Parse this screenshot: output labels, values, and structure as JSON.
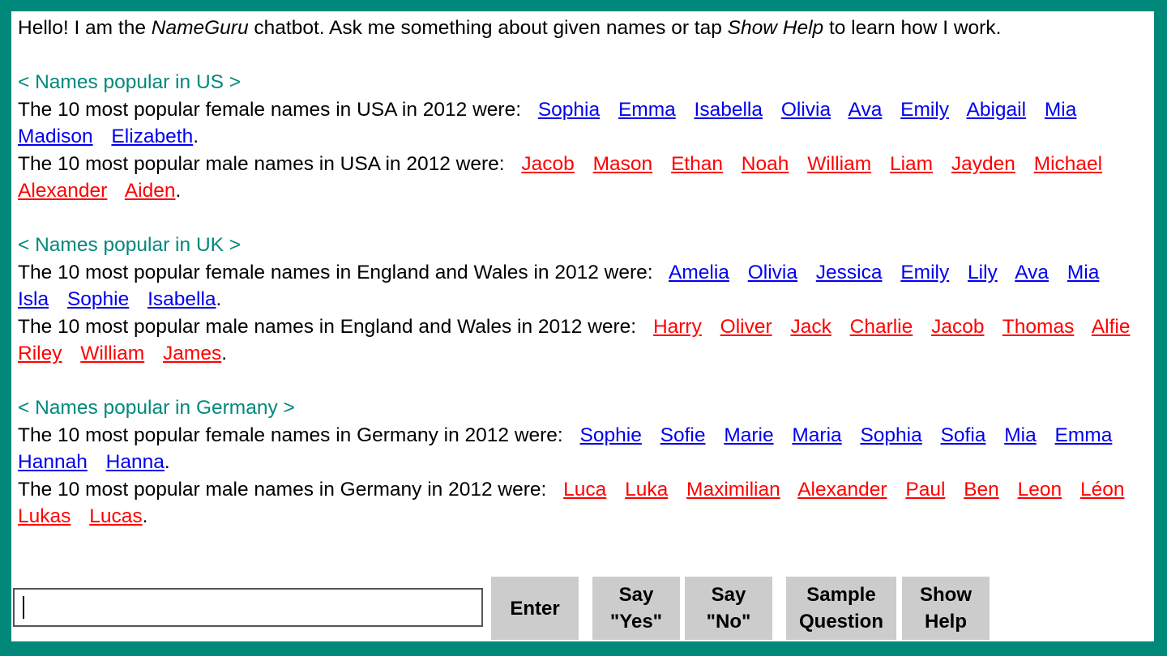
{
  "intro": {
    "text1": "Hello! I am the ",
    "bot_name": "NameGuru",
    "text2": " chatbot. Ask me something about given names or tap ",
    "help_ref": "Show Help",
    "text3": " to learn how I work."
  },
  "sections": [
    {
      "heading": "< Names popular in US >",
      "female_lead": "The 10 most popular female names in USA in 2012 were:",
      "female": [
        "Sophia",
        "Emma",
        "Isabella",
        "Olivia",
        "Ava",
        "Emily",
        "Abigail",
        "Mia",
        "Madison",
        "Elizabeth"
      ],
      "male_lead": "The 10 most popular male names in USA in 2012 were:",
      "male": [
        "Jacob",
        "Mason",
        "Ethan",
        "Noah",
        "William",
        "Liam",
        "Jayden",
        "Michael",
        "Alexander",
        "Aiden"
      ]
    },
    {
      "heading": "< Names popular in UK >",
      "female_lead": "The 10 most popular female names in England and Wales in 2012 were:",
      "female": [
        "Amelia",
        "Olivia",
        "Jessica",
        "Emily",
        "Lily",
        "Ava",
        "Mia",
        "Isla",
        "Sophie",
        "Isabella"
      ],
      "male_lead": "The 10 most popular male names in England and Wales in 2012 were:",
      "male": [
        "Harry",
        "Oliver",
        "Jack",
        "Charlie",
        "Jacob",
        "Thomas",
        "Alfie",
        "Riley",
        "William",
        "James"
      ]
    },
    {
      "heading": "< Names popular in Germany >",
      "female_lead": "The 10 most popular female names in Germany in 2012 were:",
      "female": [
        "Sophie",
        "Sofie",
        "Marie",
        "Maria",
        "Sophia",
        "Sofia",
        "Mia",
        "Emma",
        "Hannah",
        "Hanna"
      ],
      "male_lead": "The 10 most popular male names in Germany in 2012 were:",
      "male": [
        "Luca",
        "Luka",
        "Maximilian",
        "Alexander",
        "Paul",
        "Ben",
        "Leon",
        "Léon",
        "Lukas",
        "Lucas"
      ]
    }
  ],
  "input": {
    "value": ""
  },
  "buttons": {
    "enter": "Enter",
    "say_yes": "Say\n\"Yes\"",
    "say_no": "Say\n\"No\"",
    "sample": "Sample\nQuestion",
    "help": "Show\nHelp"
  },
  "colors": {
    "frame": "#00897b",
    "heading": "#00897b",
    "female": "#0000ee",
    "male": "#ff0000",
    "button": "#cccccc"
  }
}
